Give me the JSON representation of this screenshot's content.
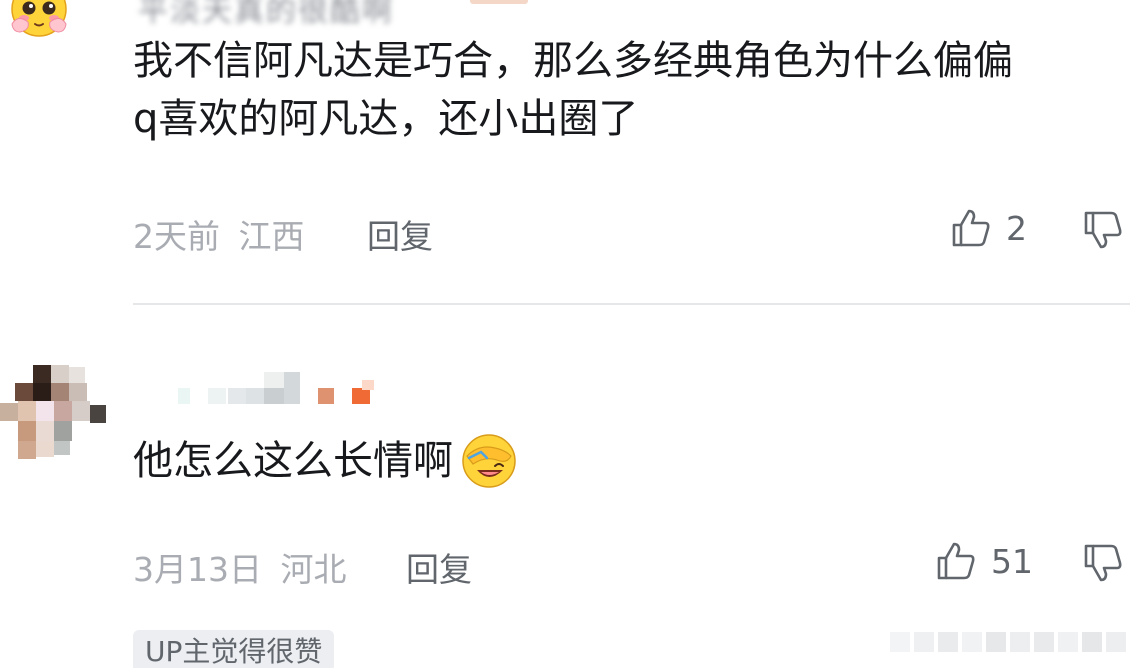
{
  "comments": [
    {
      "username": "平淡天真的很酷啊",
      "text_line1": "我不信阿凡达是巧合，那么多经典角色为什么偏偏",
      "text_line2": "q喜欢的阿凡达，还小出圈了",
      "time": "2天前",
      "location": "江西",
      "reply_label": "回复",
      "like_count": "2"
    },
    {
      "text": "他怎么这么长情啊",
      "time": "3月13日",
      "location": "河北",
      "reply_label": "回复",
      "like_count": "51",
      "tag": "UP主觉得很赞"
    }
  ],
  "icons": {
    "like": "thumbs-up-icon",
    "dislike": "thumbs-down-icon",
    "emoji_c1_avatar": "blushing-emoji-icon",
    "emoji_inline": "laughing-facepalm-emoji-icon"
  },
  "colors": {
    "text_primary": "#18191c",
    "text_meta": "#a9acb2",
    "text_action": "#61666d",
    "divider": "#e6e7e9",
    "tag_bg": "#eceef1"
  }
}
